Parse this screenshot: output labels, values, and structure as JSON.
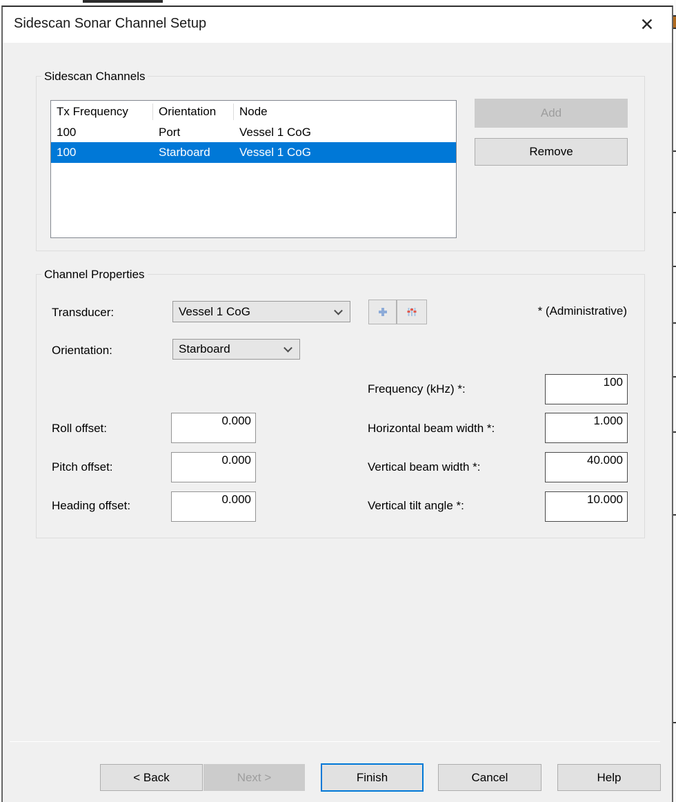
{
  "window": {
    "title": "Sidescan Sonar Channel Setup",
    "close_icon": "✕"
  },
  "channels_group": {
    "title": "Sidescan Channels",
    "table": {
      "columns": [
        "Tx Frequency",
        "Orientation",
        "Node"
      ],
      "rows": [
        {
          "tx_frequency": "100",
          "orientation": "Port",
          "node": "Vessel 1 CoG",
          "selected": false
        },
        {
          "tx_frequency": "100",
          "orientation": "Starboard",
          "node": "Vessel 1 CoG",
          "selected": true
        }
      ]
    },
    "add_label": "Add",
    "remove_label": "Remove"
  },
  "properties_group": {
    "title": "Channel Properties",
    "admin_note": "* (Administrative)",
    "transducer": {
      "label": "Transducer:",
      "value": "Vessel 1 CoG"
    },
    "orientation": {
      "label": "Orientation:",
      "value": "Starboard"
    },
    "fields": {
      "frequency": {
        "label": "Frequency (kHz) *:",
        "value": "100"
      },
      "roll": {
        "label": "Roll offset:",
        "value": "0.000"
      },
      "h_beam": {
        "label": "Horizontal beam width *:",
        "value": "1.000"
      },
      "pitch": {
        "label": "Pitch offset:",
        "value": "0.000"
      },
      "v_beam": {
        "label": "Vertical beam width *:",
        "value": "40.000"
      },
      "heading": {
        "label": "Heading offset:",
        "value": "0.000"
      },
      "tilt": {
        "label": "Vertical tilt angle *:",
        "value": "10.000"
      }
    }
  },
  "footer": {
    "back_label": "< Back",
    "next_label": "Next >",
    "finish_label": "Finish",
    "cancel_label": "Cancel",
    "help_label": "Help"
  },
  "colors": {
    "selection": "#0078d7",
    "accent": "#0078d7",
    "titlebar": "#ffffff",
    "dialog_bg": "#f0f0f0"
  }
}
